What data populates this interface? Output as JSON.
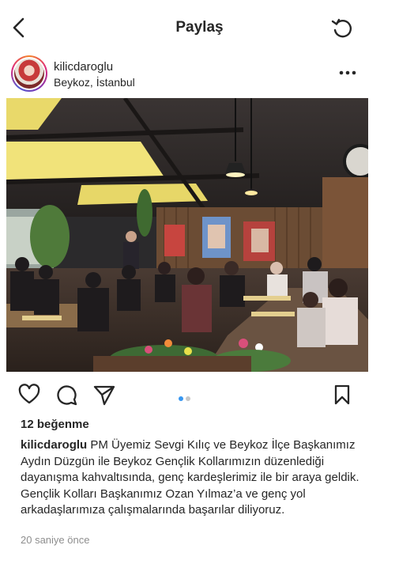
{
  "header": {
    "title": "Paylaş",
    "back_icon": "chevron-left-icon",
    "refresh_icon": "refresh-icon"
  },
  "post": {
    "username": "kilicdaroglu",
    "location": "Beykoz, İstanbul",
    "more_icon": "more-horizontal-icon",
    "photo_description_icon": "photo",
    "actions": {
      "like_icon": "heart-icon",
      "comment_icon": "comment-icon",
      "share_icon": "send-icon",
      "save_icon": "bookmark-icon"
    },
    "carousel": {
      "count": 2,
      "active": 0,
      "active_color": "#3897f0",
      "inactive_color": "#c7c7c7"
    },
    "likes": "12 beğenme",
    "caption_user": "kilicdaroglu",
    "caption_text": "PM Üyemiz Sevgi Kılıç ve Beykoz İlçe Başkanımız Aydın Düzgün ile Beykoz Gençlik Kollarımızın düzenlediği dayanışma kahvaltısında, genç kardeşlerimiz ile bir araya geldik. Gençlik Kolları Başkanımız Ozan Yılmaz’a ve genç yol arkadaşlarımıza çalışmalarında başarılar diliyoruz.",
    "timestamp": "20 saniye önce"
  }
}
